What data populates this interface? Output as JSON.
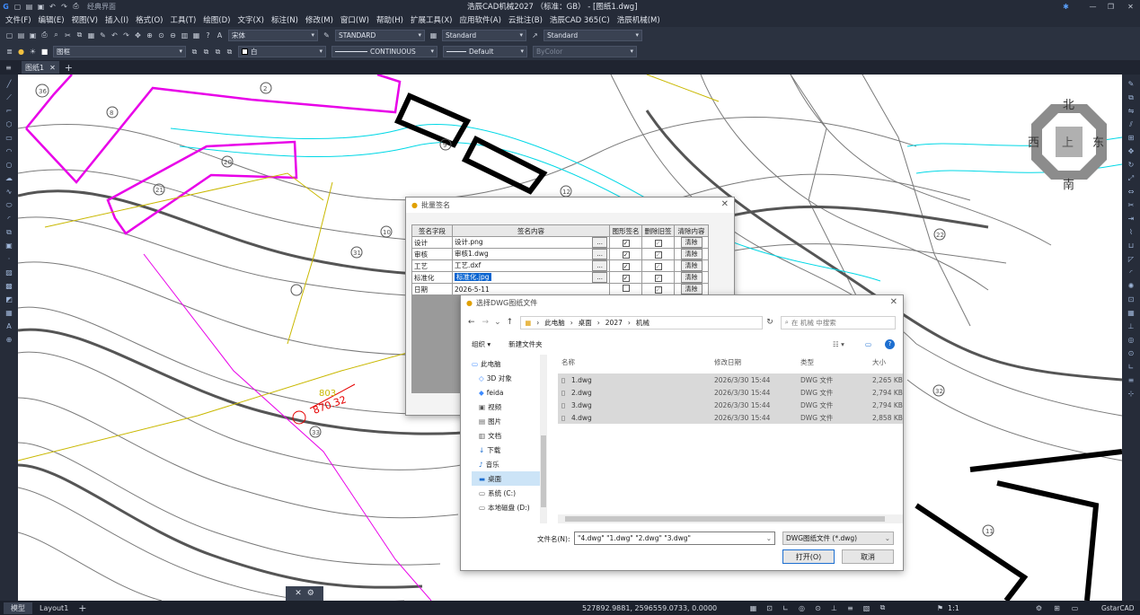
{
  "app": {
    "title": "浩辰CAD机械2027 （标准：GB） - [图纸1.dwg]",
    "quick_access_label": "经典界面"
  },
  "menu": [
    "文件(F)",
    "编辑(E)",
    "视图(V)",
    "插入(I)",
    "格式(O)",
    "工具(T)",
    "绘图(D)",
    "文字(X)",
    "标注(N)",
    "修改(M)",
    "窗口(W)",
    "帮助(H)",
    "扩展工具(X)",
    "应用软件(A)",
    "云批注(B)",
    "浩辰CAD 365(C)",
    "浩辰机械(M)"
  ],
  "toolbar": {
    "font_combo": "宋体",
    "text_style": "STANDARD",
    "dim_style": "Standard",
    "table_style": "Standard",
    "layer_combo": "图框",
    "color_combo": "白",
    "linetype_combo": "CONTINUOUS",
    "lineweight_combo": "Default",
    "plotstyle_combo": "ByColor"
  },
  "tabs": {
    "drawing_tab": "图纸1"
  },
  "compass": {
    "north": "北",
    "south": "南",
    "east": "东",
    "west": "西",
    "center": "上"
  },
  "drawing_labels": {
    "elev1": "803",
    "elev2": "870.32",
    "c1": "2",
    "c2": "36",
    "c3": "8",
    "c4": "20",
    "c5": "21",
    "c6": "31",
    "c7": "33",
    "c8": "32",
    "c9": "11",
    "c10": "12",
    "c11": "9",
    "c12": "10",
    "c13": "22"
  },
  "batch_sign": {
    "title": "批量签名",
    "headers": [
      "签名字段",
      "签名内容",
      "图形签名",
      "删除旧签",
      "清除内容"
    ],
    "rows": [
      {
        "field": "设计",
        "content": "设计.png",
        "browse": "...",
        "clear": "清除"
      },
      {
        "field": "审核",
        "content": "审核1.dwg",
        "browse": "...",
        "clear": "清除"
      },
      {
        "field": "工艺",
        "content": "工艺.dxf",
        "browse": "...",
        "clear": "清除"
      },
      {
        "field": "标准化",
        "content": "标准化.jpg",
        "browse": "...",
        "clear": "清除"
      },
      {
        "field": "日期",
        "content": "2026-5-11",
        "browse": "",
        "clear": "清除"
      }
    ]
  },
  "file_dialog": {
    "title": "选择DWG图纸文件",
    "path": [
      "此电脑",
      "桌面",
      "2027",
      "机械"
    ],
    "search_placeholder": "在 机械 中搜索",
    "organize": "组织 ▾",
    "new_folder": "新建文件夹",
    "tree": [
      "此电脑",
      "3D 对象",
      "feida",
      "视频",
      "图片",
      "文档",
      "下载",
      "音乐",
      "桌面",
      "系统 (C:)",
      "本地磁盘 (D:)"
    ],
    "columns": [
      "名称",
      "修改日期",
      "类型",
      "大小"
    ],
    "files": [
      {
        "name": "1.dwg",
        "date": "2026/3/30 15:44",
        "type": "DWG 文件",
        "size": "2,265 KB"
      },
      {
        "name": "2.dwg",
        "date": "2026/3/30 15:44",
        "type": "DWG 文件",
        "size": "2,794 KB"
      },
      {
        "name": "3.dwg",
        "date": "2026/3/30 15:44",
        "type": "DWG 文件",
        "size": "2,794 KB"
      },
      {
        "name": "4.dwg",
        "date": "2026/3/30 15:44",
        "type": "DWG 文件",
        "size": "2,858 KB"
      }
    ],
    "filename_label": "文件名(N):",
    "filename_value": "\"4.dwg\" \"1.dwg\" \"2.dwg\" \"3.dwg\"",
    "filetype": "DWG图纸文件 (*.dwg)",
    "open": "打开(O)",
    "cancel": "取消"
  },
  "status": {
    "model_tab": "模型",
    "layout_tab": "Layout1",
    "coords": "527892.9881, 2596559.0733, 0.0000",
    "scale": "1:1",
    "brand": "GstarCAD"
  }
}
